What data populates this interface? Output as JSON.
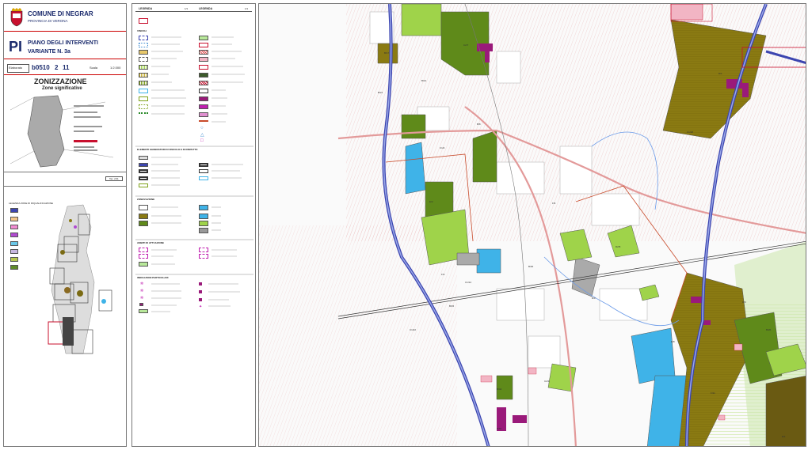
{
  "header": {
    "municipality": "COMUNE DI NEGRAR",
    "province": "PROVINCIA DI VERONA",
    "plan_abbr": "PI",
    "plan_title": "PIANO DEGLI INTERVENTI",
    "variant": "VARIANTE N. 3a",
    "elaborato_label": "Elaborato",
    "elaborato_code": "b0510",
    "sheet_a": "2",
    "sheet_b": "11",
    "scale_label": "Scala",
    "scale_value": "1:2.000"
  },
  "title_block": {
    "title": "ZONIZZAZIONE",
    "subtitle": "Zone significative"
  },
  "inset": {
    "sheet_box_label": "Tav. 2/11",
    "heading": "LEGENDA ZONE DI RIQUALIFICAZIONE"
  },
  "legend": {
    "col1_header": "LEGENDA",
    "col1_page": "1/1",
    "col2_header": "LEGENDA",
    "col2_page": "1/1",
    "section_vincoli": "VINCOLI",
    "section_elementi": "ELEMENTI GENERATORI DI VINCOLO E DI RISPETTO",
    "section_zonizzazione": "ZONIZZAZIONE",
    "section_ambiti": "AMBITI DI ATTUAZIONE",
    "section_indicazioni": "INDICAZIONI PARTICOLARI"
  },
  "map_labels": [
    "B/17",
    "C2/7",
    "B/12",
    "D/1",
    "B/21",
    "C1/4",
    "B/8",
    "E/2",
    "F/3",
    "B/30",
    "C1/12",
    "D2/5",
    "B/15",
    "E/8",
    "F/11",
    "C2/3",
    "B/44",
    "B/9",
    "D/3",
    "C1/18",
    "B/26",
    "E/1",
    "F/6",
    "B/50",
    "C1/22"
  ],
  "colors": {
    "olive": "#8a7a12",
    "green": "#7fa21a",
    "lightgreen": "#9fd34a",
    "blue_river": "#3c45b0",
    "pink": "#f2b5c4",
    "magenta": "#9a1a7a",
    "cyan": "#3fb3e8"
  }
}
